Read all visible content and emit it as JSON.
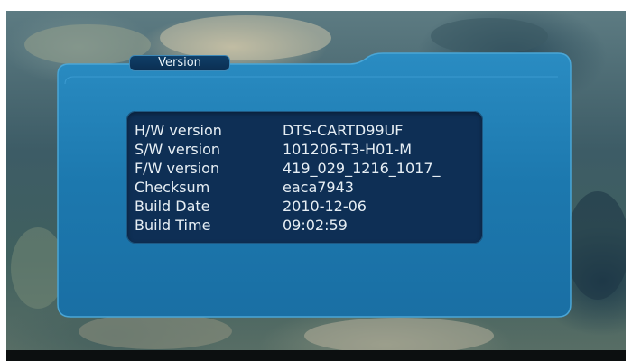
{
  "dialog": {
    "title": "Version",
    "rows": [
      {
        "label": "H/W version",
        "value": "DTS-CARTD99UF"
      },
      {
        "label": "S/W version",
        "value": "101206-T3-H01-M"
      },
      {
        "label": "F/W version",
        "value": "419_029_1216_1017_"
      },
      {
        "label": "Checksum",
        "value": "eaca7943"
      },
      {
        "label": "Build Date",
        "value": "2010-12-06"
      },
      {
        "label": "Build Time",
        "value": "09:02:59"
      }
    ]
  },
  "colors": {
    "dialog_fill": "#1c7ab0",
    "dialog_inner": "#1568a0",
    "panel_fill": "#0e2f55",
    "text": "#e6eef4"
  }
}
